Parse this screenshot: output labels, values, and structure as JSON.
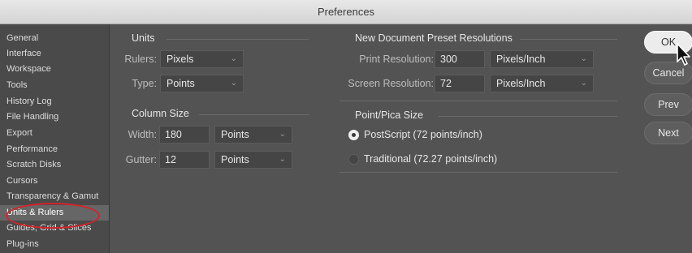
{
  "window": {
    "title": "Preferences"
  },
  "sidebar": {
    "items": [
      {
        "label": "General"
      },
      {
        "label": "Interface"
      },
      {
        "label": "Workspace"
      },
      {
        "label": "Tools"
      },
      {
        "label": "History Log"
      },
      {
        "label": "File Handling"
      },
      {
        "label": "Export"
      },
      {
        "label": "Performance"
      },
      {
        "label": "Scratch Disks"
      },
      {
        "label": "Cursors"
      },
      {
        "label": "Transparency & Gamut"
      },
      {
        "label": "Units & Rulers",
        "selected": true
      },
      {
        "label": "Guides, Grid & Slices"
      },
      {
        "label": "Plug-ins"
      }
    ],
    "annotation_color": "#d2252a"
  },
  "units": {
    "title": "Units",
    "rulers_label": "Rulers:",
    "rulers_value": "Pixels",
    "type_label": "Type:",
    "type_value": "Points"
  },
  "column_size": {
    "title": "Column Size",
    "width_label": "Width:",
    "width_value": "180",
    "width_unit": "Points",
    "gutter_label": "Gutter:",
    "gutter_value": "12",
    "gutter_unit": "Points"
  },
  "new_doc": {
    "title": "New Document Preset Resolutions",
    "print_label": "Print Resolution:",
    "print_value": "300",
    "print_unit": "Pixels/Inch",
    "screen_label": "Screen Resolution:",
    "screen_value": "72",
    "screen_unit": "Pixels/Inch"
  },
  "point_pica": {
    "title": "Point/Pica Size",
    "option_postscript": "PostScript (72 points/inch)",
    "option_traditional": "Traditional (72.27 points/inch)",
    "selected": "postscript"
  },
  "buttons": {
    "ok": "OK",
    "cancel": "Cancel",
    "prev": "Prev",
    "next": "Next"
  },
  "icons": {
    "dropdown": "chevron-down-icon",
    "cursor": "pointer-cursor-icon"
  }
}
